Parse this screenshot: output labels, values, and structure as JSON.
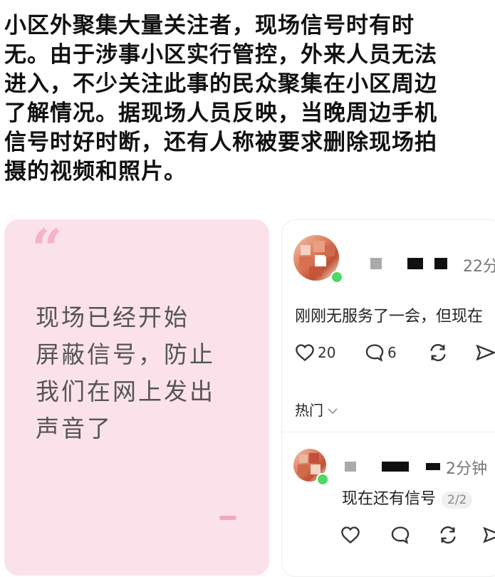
{
  "article": {
    "lines": [
      "小区外聚集大量关注者，现场信号时有时",
      "无。由于涉事小区实行管控，外来人员无法",
      "进入，不少关注此事的民众聚集在小区周边",
      "了解情况。据现场人员反映，当晚周边手机",
      "信号时好时断，还有人称被要求删除现场拍",
      "摄的视频和照片。"
    ]
  },
  "quote_card": {
    "mark": "“",
    "lines": [
      "现场已经开始",
      "屏蔽信号，防止",
      "我们在网上发出",
      "声音了"
    ]
  },
  "post": {
    "time": "22分",
    "text": "刚刚无服务了一会，但现在",
    "likes": "20",
    "comments": "6",
    "sort_label": "热门"
  },
  "reply": {
    "time": "2分钟",
    "text": "现在还有信号",
    "page_badge": "2/2"
  },
  "icons": [
    "heart-icon",
    "comment-icon",
    "repost-icon",
    "share-icon",
    "chevron-down-icon"
  ],
  "colors": {
    "card_pink": "#fbe2ea",
    "quote_pink": "#f5b3c8",
    "online_green": "#4cd964"
  }
}
